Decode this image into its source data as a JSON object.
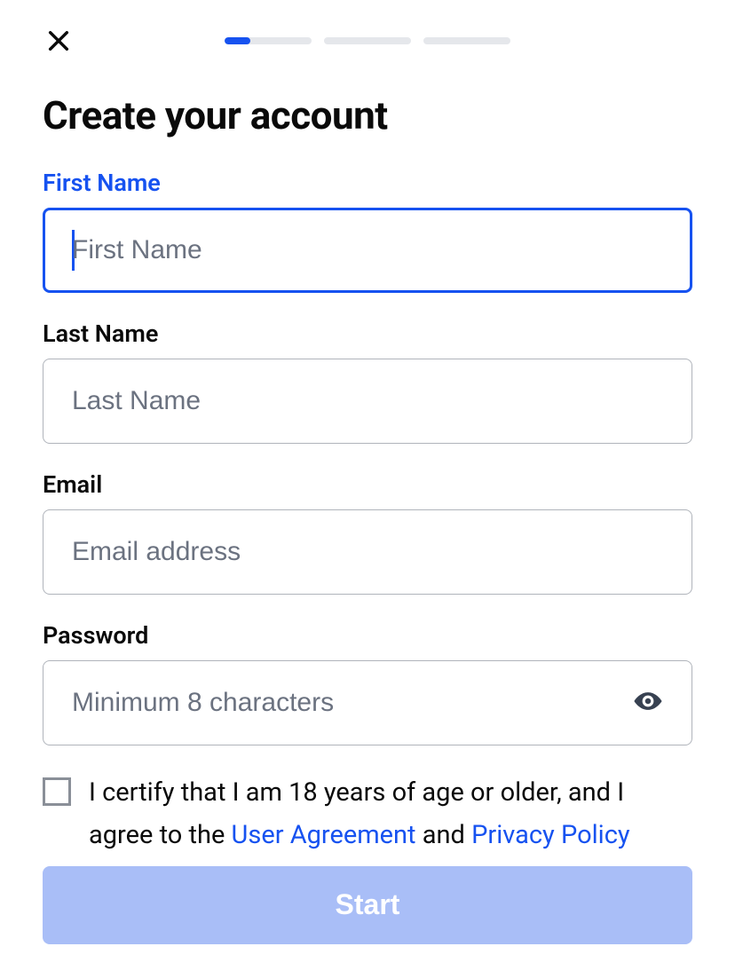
{
  "header": {
    "progress_segments": 3,
    "progress_current_fill_percent": 30
  },
  "title": "Create your account",
  "fields": {
    "first_name": {
      "label": "First Name",
      "placeholder": "First Name",
      "value": "",
      "active": true
    },
    "last_name": {
      "label": "Last Name",
      "placeholder": "Last Name",
      "value": ""
    },
    "email": {
      "label": "Email",
      "placeholder": "Email address",
      "value": ""
    },
    "password": {
      "label": "Password",
      "placeholder": "Minimum 8 characters",
      "value": ""
    }
  },
  "consent": {
    "checked": false,
    "text_part1": "I certify that I am 18 years of age or older, and I agree to the ",
    "link1": "User Agreement",
    "text_part2": " and ",
    "link2": "Privacy Policy"
  },
  "cta": {
    "label": "Start",
    "enabled": false
  },
  "colors": {
    "accent": "#1652f0",
    "disabled_button": "#a9bef7",
    "border": "#b0b4bb",
    "placeholder": "#6b7280"
  }
}
